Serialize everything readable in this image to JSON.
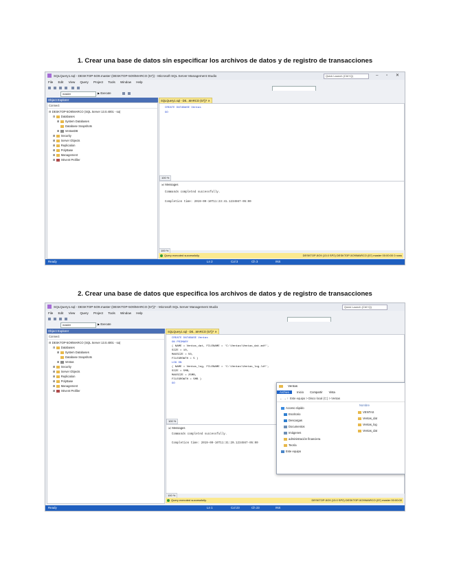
{
  "heading1": "1. Crear una base de datos sin especificar los archivos de datos y de registro de transacciones",
  "heading2": "2. Crear una base de datos que especifica los archivos de datos y de registro de transacciones",
  "colors": {
    "accent": "#1f5fbf",
    "tab_active": "#fbe98f",
    "success": "#2e9b36",
    "folder": "#e7b84a"
  },
  "ssms1": {
    "window_title": "SQLQuery1.sql - DESKTOP-5O9.master (DESKTOP-5O9\\MARCO (57)) - Microsoft SQL Server Management Studio",
    "quick_launch": "Quick Launch (Ctrl+Q)",
    "menu": [
      "File",
      "Edit",
      "View",
      "Query",
      "Project",
      "Tools",
      "Window",
      "Help"
    ],
    "db_combo": "master",
    "execute_label": "Execute",
    "object_explorer_title": "Object Explorer",
    "connect_label": "Connect",
    "tree": [
      "DESKTOP-5O9\\MARCO (SQL Server 13.0.4001 - sa)",
      "Databases",
      "System Databases",
      "Database Snapshots",
      "VentasDB",
      "Security",
      "Server Objects",
      "Replication",
      "PolyBase",
      "Management",
      "XEvent Profiler"
    ],
    "tab_label": "SQLQuery1.sql - DE...MARCO (57))*",
    "code": [
      "CREATE DATABASE Ventas",
      "GO"
    ],
    "zoom": "100 %",
    "messages_tab": "Messages",
    "messages": [
      "Commands completed successfully.",
      "Completion time: 2019-09-10T11:23:41.1234567-05:00"
    ],
    "query_status": "Query executed successfully.",
    "query_status_right": "DESKTOP-5O9 (13.0 SP2)   DESKTOP-5O9\\MARCO (57)   master   00:00:00   0 rows",
    "statusbar": [
      "Ready",
      "Ln 2",
      "Col 3",
      "Ch 3",
      "INS"
    ]
  },
  "ssms2": {
    "window_title": "SQLQuery1.sql - DESKTOP-5O9.master (DESKTOP-5O9\\MARCO (57))* - Microsoft SQL Server Management Studio",
    "quick_launch": "Quick Launch (Ctrl+Q)",
    "menu": [
      "File",
      "Edit",
      "View",
      "Query",
      "Project",
      "Tools",
      "Window",
      "Help"
    ],
    "db_combo": "master",
    "execute_label": "Execute",
    "object_explorer_title": "Object Explorer",
    "connect_label": "Connect",
    "tree": [
      "DESKTOP-5O9\\MARCO (SQL Server 13.0.4001 - sa)",
      "Databases",
      "System Databases",
      "Database Snapshots",
      "Ventas",
      "Security",
      "Server Objects",
      "Replication",
      "PolyBase",
      "Management",
      "XEvent Profiler"
    ],
    "tab_label": "SQLQuery1.sql - DE...MARCO (57))*",
    "code": [
      "CREATE DATABASE Ventas",
      "ON PRIMARY",
      "( NAME = Ventas_dat,     FILENAME = 'C:\\Ventas\\Ventas_dat.mdf',",
      "  SIZE = 10,",
      "  MAXSIZE = 50,",
      "  FILEGROWTH = 5 )",
      "LOG ON",
      "( NAME = Ventas_log,    FILENAME = 'C:\\Ventas\\Ventas_log.ldf',",
      "  SIZE = 5MB,",
      "  MAXSIZE = 25MB,",
      "  FILEGROWTH = 5MB )",
      "GO"
    ],
    "zoom": "100 %",
    "messages_tab": "Messages",
    "messages": [
      "Commands completed successfully.",
      "Completion time: 2019-09-10T11:31:20.1234567-05:00"
    ],
    "query_status": "Query executed successfully.",
    "query_status_right": "DESKTOP-5O9 (13.0 SP2)   DESKTOP-5O9\\MARCO (57)   master   00:00:00",
    "statusbar": [
      "Ready",
      "Ln 1",
      "Col 23",
      "Ch 23",
      "INS"
    ]
  },
  "explorer": {
    "title": "Ventas",
    "ribbon": [
      "Archivo",
      "Inicio",
      "Compartir",
      "Vista"
    ],
    "address": "Este equipo  >  Disco local (C:)  >  Ventas",
    "nav": [
      "Acceso rápido",
      "Escritorio",
      "Descargas",
      "Documentos",
      "Imágenes",
      "administración financiera",
      "Teoría",
      "Este equipo"
    ],
    "column_header": "Nombre",
    "files": [
      "VENTAS",
      "Ventas_dat",
      "Ventas_log",
      "Ventas_dat"
    ]
  }
}
